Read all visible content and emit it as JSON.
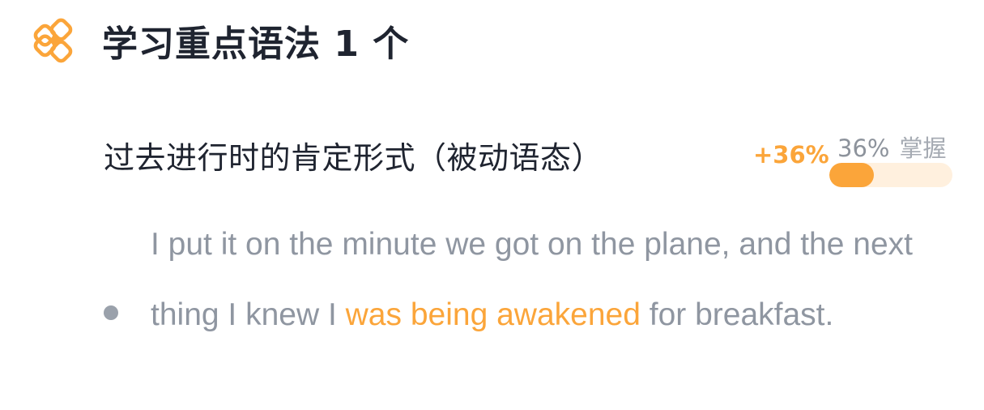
{
  "header": {
    "title": "学习重点语法 1 个",
    "icon": "grammar-badge-icon",
    "accent_color": "#fba53a"
  },
  "grammar": {
    "name": "过去进行时的肯定形式（被动语态）",
    "delta": "+36%",
    "mastery_percent_text": "36%",
    "mastery_label": "掌握",
    "mastery_fraction": 0.36
  },
  "example": {
    "before": "I put it on the minute we got on the plane, and the next thing I knew I ",
    "highlight": "was being awakened",
    "after": " for breakfast.",
    "highlight_color": "#fba53a"
  }
}
